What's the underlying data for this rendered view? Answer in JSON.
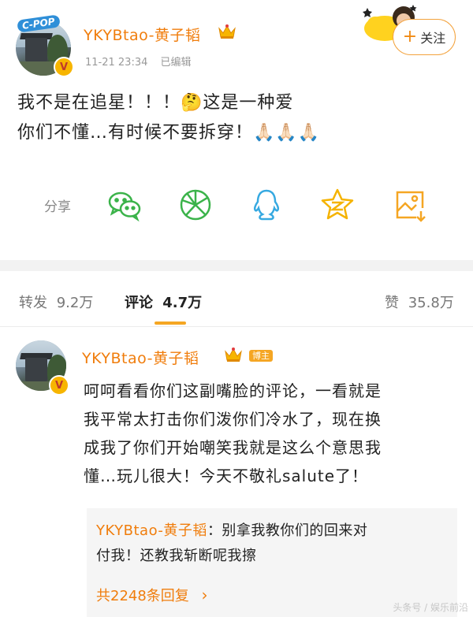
{
  "post": {
    "author": "YKYBtao-黄子韬",
    "avatar_tag": "C-POP",
    "time": "11-21 23:34",
    "edited": "已编辑",
    "follow_label": "关注",
    "text_line1": "我不是在追星！！！",
    "text_line1b": "这是一种爱",
    "text_line2": "你们不懂…有时候不要拆穿！",
    "emoji_thinking": "🤔",
    "emoji_pray": "🙏🏻🙏🏻🙏🏻"
  },
  "share": {
    "label": "分享",
    "targets": [
      "wechat-icon",
      "moments-icon",
      "qq-icon",
      "qzone-icon",
      "save-image-icon"
    ]
  },
  "tabs": {
    "repost_label": "转发",
    "repost_count": "9.2万",
    "comment_label": "评论",
    "comment_count": "4.7万",
    "like_label": "赞",
    "like_count": "35.8万"
  },
  "comment": {
    "author": "YKYBtao-黄子韬",
    "badge": "博主",
    "line1": "呵呵看看你们这副嘴脸的评论，一看就是",
    "line2": "我平常太打击你们泼你们冷水了，现在换",
    "line3": "成我了你们开始嘲笑我就是这么个意思我",
    "line4": "懂…玩儿很大！今天不敬礼salute了！",
    "reply_author": "YKYBtao-黄子韬",
    "reply_line1": "：别拿我教你们的回来对",
    "reply_line2": "付我！还教我斩断呢我擦",
    "reply_count": "共2248条回复"
  },
  "colors": {
    "accent": "#f07d0c",
    "highlight": "#f5a623",
    "wechat": "#3bb34a",
    "qq": "#36a9e1"
  },
  "watermark": "头条号 / 娱乐前沿"
}
